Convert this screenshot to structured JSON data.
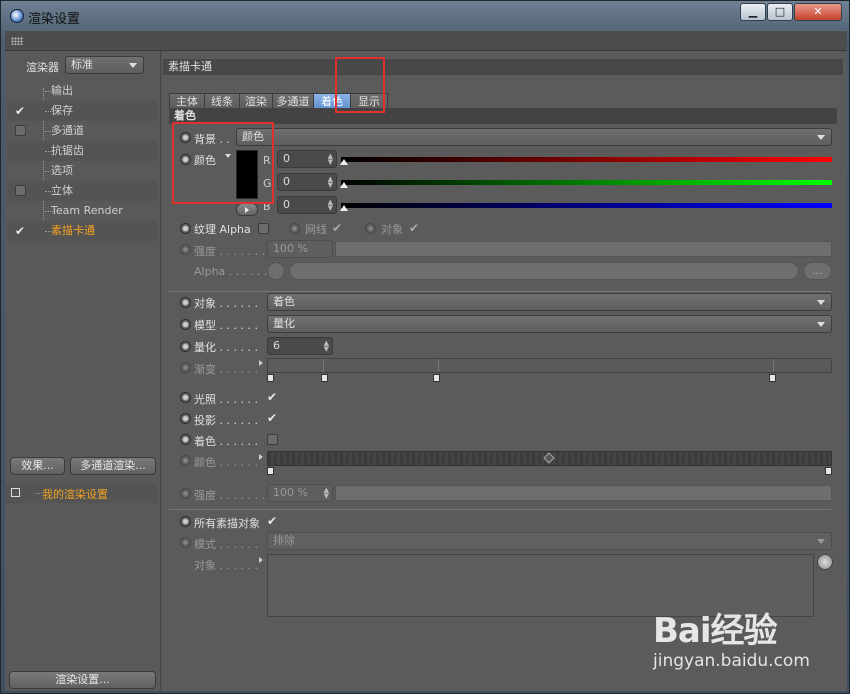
{
  "window": {
    "title": "渲染设置",
    "minimize": "▁",
    "maximize": "□",
    "close": "✕"
  },
  "sidebar": {
    "renderer_label": "渲染器",
    "renderer_value": "标准",
    "items": [
      {
        "label": "输出",
        "checked": false,
        "has_checkbox": false
      },
      {
        "label": "保存",
        "checked": true,
        "has_checkbox": true
      },
      {
        "label": "多通道",
        "checked": false,
        "has_checkbox": true
      },
      {
        "label": "抗锯齿",
        "checked": false,
        "has_checkbox": false
      },
      {
        "label": "选项",
        "checked": false,
        "has_checkbox": false
      },
      {
        "label": "立体",
        "checked": false,
        "has_checkbox": true
      },
      {
        "label": "Team Render",
        "checked": false,
        "has_checkbox": false
      },
      {
        "label": "素描卡通",
        "checked": true,
        "has_checkbox": true,
        "active": true
      }
    ],
    "effects_button": "效果...",
    "multipass_button": "多通道渲染...",
    "preset_label": "我的渲染设置",
    "render_settings_button": "渲染设置..."
  },
  "panel": {
    "title": "素描卡通",
    "tabs": [
      "主体",
      "线条",
      "渲染",
      "多通道",
      "着色",
      "显示"
    ],
    "active_tab": "着色",
    "section": "着色",
    "background": {
      "label": "背景 . .",
      "value": "颜色"
    },
    "color": {
      "label": "颜色",
      "r_label": "R",
      "g_label": "G",
      "b_label": "B",
      "r": "0",
      "g": "0",
      "b": "0",
      "swatch": "#000000"
    },
    "texture_alpha": {
      "label": "纹理 Alpha",
      "wire_label": "网线",
      "object_label": "对象"
    },
    "strength1": {
      "label": "强度 . . . . . . .",
      "value": "100 %"
    },
    "alpha": {
      "label": "Alpha . . . . . .",
      "more": "..."
    },
    "object": {
      "label": "对象 . . . . . .",
      "value": "着色"
    },
    "model": {
      "label": "模型 . . . . . .",
      "value": "量化"
    },
    "quantize": {
      "label": "量化 . . . . . .",
      "value": "6"
    },
    "gradient_label": "渐变 . . . . . .",
    "lighting_label": "光照 . . . . . .",
    "shadow_label": "投影 . . . . . .",
    "shading_label": "着色 . . . . . .",
    "color2_label": "颜色 . . . . . .",
    "strength2": {
      "label": "强度 . . . . . . .",
      "value": "100 %"
    },
    "all_sketch_label": "所有素描对象",
    "mode": {
      "label": "模式 . . . . . .",
      "value": "排除"
    },
    "objects_label": "对象 . . . . . ."
  },
  "watermark": {
    "brand": "Bai经验",
    "url": "jingyan.baidu.com"
  },
  "colors": {
    "accent": "#f0a020",
    "tab_active": "#7aa6e0",
    "highlight": "#e0312c"
  }
}
